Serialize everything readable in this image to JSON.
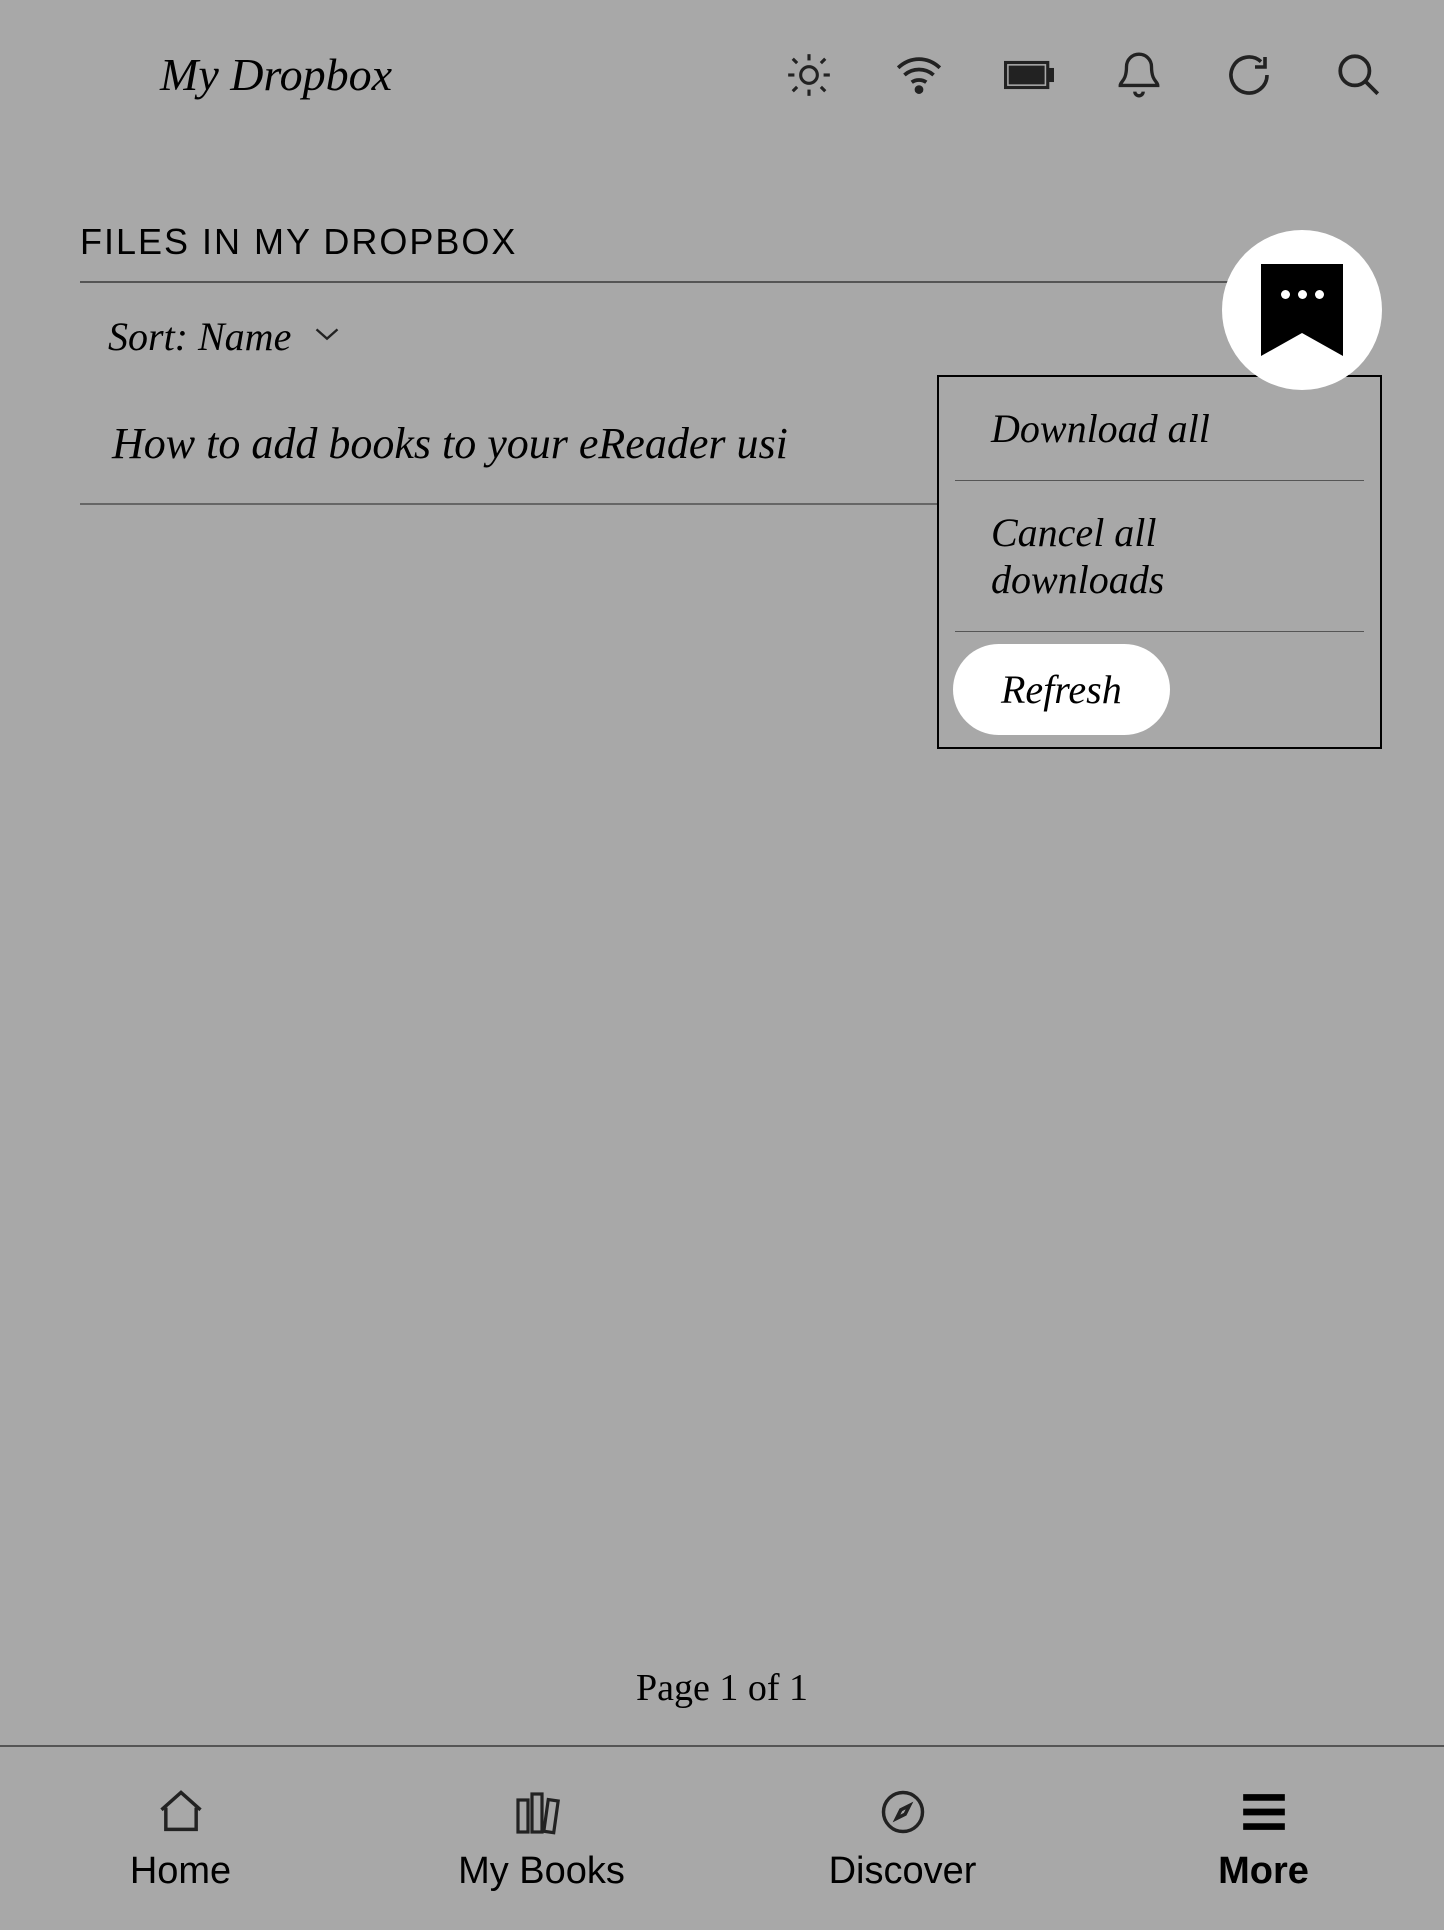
{
  "header": {
    "title": "My Dropbox"
  },
  "section": {
    "title": "FILES IN MY DROPBOX",
    "sort_label": "Sort: Name",
    "files": [
      "How to add books to your eReader usi"
    ]
  },
  "menu": {
    "items": [
      "Download all",
      "Cancel all downloads",
      "Refresh"
    ]
  },
  "pagination": "Page 1 of 1",
  "nav": {
    "home": "Home",
    "mybooks": "My Books",
    "discover": "Discover",
    "more": "More"
  }
}
